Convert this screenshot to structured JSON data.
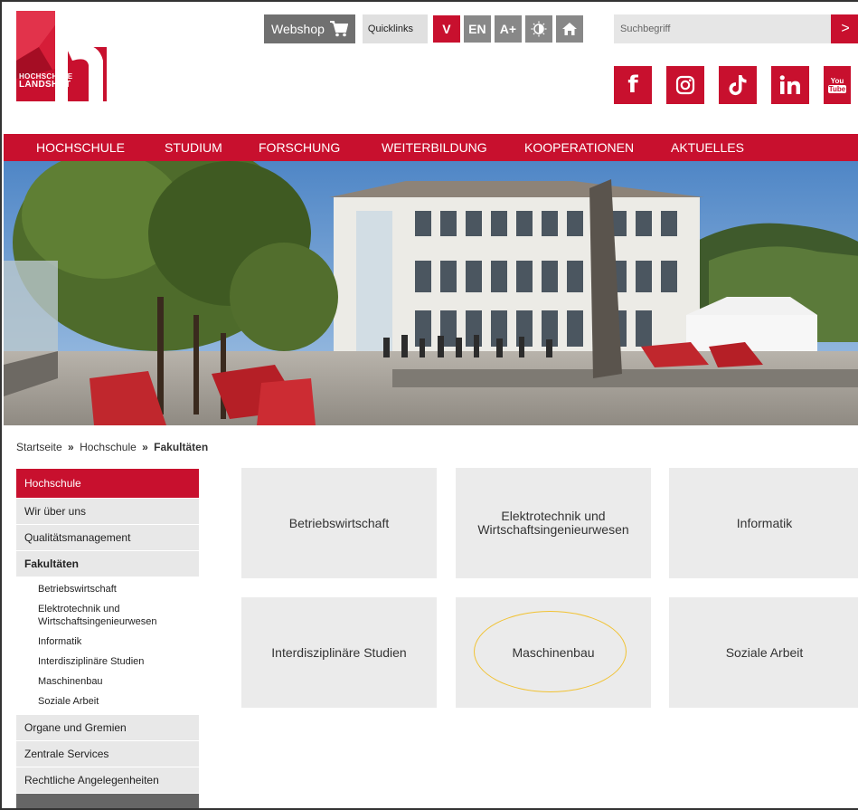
{
  "logo": {
    "line1": "HOCHSCHULE",
    "line2": "LANDSHUT"
  },
  "topbar": {
    "webshop_label": "Webshop",
    "quicklinks_label": "Quicklinks",
    "quicklinks_toggle": "V",
    "lang_label": "EN",
    "font_size_label": "A+",
    "search_placeholder": "Suchbegriff",
    "search_go": ">"
  },
  "social": {
    "facebook": "f",
    "youtube_line1": "You",
    "youtube_line2": "Tube"
  },
  "nav": {
    "items": [
      "HOCHSCHULE",
      "STUDIUM",
      "FORSCHUNG",
      "WEITERBILDUNG",
      "KOOPERATIONEN",
      "AKTUELLES"
    ]
  },
  "breadcrumb": {
    "home": "Startseite",
    "sep": "»",
    "parent": "Hochschule",
    "current": "Fakultäten"
  },
  "sidebar": {
    "head": "Hochschule",
    "items_top": [
      "Wir über uns",
      "Qualitätsmanagement"
    ],
    "active": "Fakultäten",
    "sub_items": [
      "Betriebswirtschaft",
      "Elektrotechnik und Wirtschaftsingenieurwesen",
      "Informatik",
      "Interdisziplinäre Studien",
      "Maschinenbau",
      "Soziale Arbeit"
    ],
    "items_bottom": [
      "Organe und Gremien",
      "Zentrale Services",
      "Rechtliche Angelegenheiten"
    ]
  },
  "tiles": [
    "Betriebswirtschaft",
    "Elektrotechnik und Wirtschaftsingenieurwesen",
    "Informatik",
    "Interdisziplinäre Studien",
    "Maschinenbau",
    "Soziale Arbeit"
  ],
  "colors": {
    "brand_red": "#c8102e",
    "tile_bg": "#ebebeb",
    "highlight": "#f1c232"
  }
}
